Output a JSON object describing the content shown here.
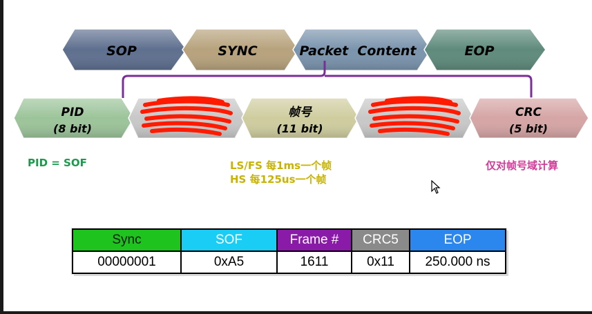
{
  "top_row": [
    {
      "label": "SOP",
      "color": "#5e6f8f"
    },
    {
      "label": "SYNC",
      "color": "#b7a27c"
    },
    {
      "label": "Packet  Content",
      "color": "#7a94ad"
    },
    {
      "label": "EOP",
      "color": "#5e8a7c"
    }
  ],
  "bottom_row": [
    {
      "line1": "PID",
      "line2": "(8 bit)",
      "color": "#9cc49a"
    },
    {
      "line1": "",
      "line2": "",
      "color": "#c8c8c8",
      "scribble": true
    },
    {
      "line1": "帧号",
      "line2": "(11 bit)",
      "color": "#cfcd9f"
    },
    {
      "line1": "",
      "line2": "",
      "color": "#c8c8c8",
      "scribble": true
    },
    {
      "line1": "CRC",
      "line2": "(5 bit)",
      "color": "#d6a5a5"
    }
  ],
  "notes": {
    "pid": "PID = SOF",
    "frame_line1": "LS/FS 每1ms一个帧",
    "frame_line2": "HS 每125us一个帧",
    "crc": "仅对帧号域计算"
  },
  "colors": {
    "bracket": "#7b2e9a",
    "scribble": "#ff1a00"
  },
  "table": {
    "headers": [
      {
        "label": "Sync",
        "bg": "#1ec31e",
        "fg": "#1a1a1a"
      },
      {
        "label": "SOF",
        "bg": "#19cdf5",
        "fg": "#ffffff"
      },
      {
        "label": "Frame #",
        "bg": "#8a1aa8",
        "fg": "#ffffff"
      },
      {
        "label": "CRC5",
        "bg": "#8a8a8a",
        "fg": "#ffffff"
      },
      {
        "label": "EOP",
        "bg": "#2b87ee",
        "fg": "#ffffff"
      }
    ],
    "row": [
      "00000001",
      "0xA5",
      "1611",
      "0x11",
      "250.000 ns"
    ]
  }
}
